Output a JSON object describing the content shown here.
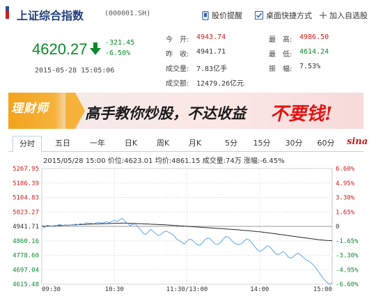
{
  "header": {
    "title": "上证综合指数",
    "code": "(000001.SH)",
    "links": [
      {
        "label": "股价提醒",
        "icon": "phone-icon"
      },
      {
        "label": "桌面快捷方式",
        "icon": "checkbox-icon"
      },
      {
        "label": "加入自选股",
        "icon": "plus-icon"
      }
    ]
  },
  "quote": {
    "price": "4620.27",
    "change": "-321.45",
    "change_pct": "-6.50%",
    "time": "2015-05-28 15:05:06",
    "stats": [
      {
        "label": "今　开:",
        "value": "4943.74",
        "tone": "red"
      },
      {
        "label": "昨　收:",
        "value": "4941.71",
        "tone": "dark"
      },
      {
        "label": "成交量:",
        "value": "7.83亿手",
        "tone": "dark"
      },
      {
        "label": "成交额:",
        "value": "12479.26亿元",
        "tone": "dark"
      },
      {
        "label": "最　高:",
        "value": "4986.50",
        "tone": "red"
      },
      {
        "label": "最　低:",
        "value": "4614.24",
        "tone": "green"
      },
      {
        "label": "振　幅:",
        "value": "7.53%",
        "tone": "dark"
      }
    ]
  },
  "banner": {
    "logo": "理财师",
    "slogan": "高手教你炒股，不达收益",
    "cta": "不要钱!"
  },
  "tabs": [
    "分时",
    "五日",
    "一年",
    "日K",
    "周K",
    "月K",
    "5分",
    "15分",
    "30分",
    "60分"
  ],
  "active_tab": 0,
  "sina_logo": "sina",
  "info_line": "2015/05/28 15:00 价位:4623.01 均价:4861.15 成交量:74万 涨幅:-6.45%",
  "colors": {
    "up": "#d21a1a",
    "down": "#0a8a2a",
    "price_line": "#5aa6e8",
    "avg_line": "#222222",
    "accent": "#1f3f7a"
  },
  "chart_data": {
    "type": "line",
    "y_left_ticks": [
      "5267.95",
      "5186.39",
      "5104.83",
      "5023.27",
      "4941.71",
      "4860.16",
      "4778.60",
      "4697.04",
      "4615.48"
    ],
    "y_right_ticks": [
      "6.60%",
      "4.95%",
      "3.30%",
      "1.65%",
      "0",
      "-1.65%",
      "-3.30%",
      "-4.95%",
      "-6.60%"
    ],
    "x_ticks": [
      "09:30",
      "10:30",
      "11:30/13:00",
      "14:00",
      "15:00"
    ],
    "ylim": [
      4615.48,
      5267.95
    ],
    "series": [
      {
        "values": [
          4943.7,
          4934,
          4948,
          4945,
          4944,
          4940,
          4948,
          4952,
          4947,
          4950,
          4946,
          4949,
          4948,
          4955,
          4951,
          4957,
          4953,
          4962,
          4958,
          4960,
          4956,
          4962,
          4965,
          4960,
          4963,
          4968,
          4962,
          4970,
          4975,
          4968,
          4978,
          4986.5,
          4973,
          4960,
          4946,
          4952,
          4956,
          4940,
          4925,
          4905,
          4895,
          4910,
          4925,
          4912,
          4900,
          4890,
          4896,
          4910,
          4915,
          4908,
          4900,
          4890,
          4870,
          4862,
          4852,
          4842,
          4858,
          4870,
          4865,
          4850,
          4838,
          4835,
          4850,
          4868,
          4875,
          4870,
          4855,
          4842,
          4840,
          4852,
          4870,
          4884,
          4880,
          4866,
          4850,
          4842,
          4838,
          4845,
          4858,
          4870,
          4865,
          4850,
          4830,
          4812,
          4800,
          4806,
          4820,
          4832,
          4826,
          4808,
          4790,
          4782,
          4788,
          4800,
          4790,
          4770,
          4762,
          4770,
          4784,
          4790,
          4778,
          4765,
          4752,
          4745,
          4735,
          4720,
          4700,
          4680,
          4660,
          4640,
          4625,
          4614.2,
          4623.0
        ]
      },
      {
        "values": [
          4943.7,
          4942,
          4943,
          4944,
          4944,
          4945,
          4946,
          4946,
          4947,
          4948,
          4948,
          4949,
          4950,
          4950,
          4951,
          4952,
          4952,
          4953,
          4954,
          4954,
          4955,
          4955,
          4956,
          4956,
          4957,
          4957,
          4958,
          4958,
          4959,
          4959,
          4959,
          4960,
          4960,
          4959,
          4959,
          4958,
          4958,
          4957,
          4957,
          4956,
          4955,
          4955,
          4954,
          4953,
          4953,
          4952,
          4951,
          4951,
          4950,
          4949,
          4948,
          4947,
          4946,
          4945,
          4944,
          4943,
          4942,
          4941,
          4940,
          4939,
          4938,
          4937,
          4936,
          4935,
          4934,
          4933,
          4932,
          4931,
          4930,
          4929,
          4928,
          4927,
          4926,
          4925,
          4924,
          4923,
          4922,
          4920,
          4919,
          4918,
          4917,
          4915,
          4914,
          4912,
          4911,
          4909,
          4907,
          4906,
          4904,
          4902,
          4900,
          4898,
          4896,
          4894,
          4892,
          4890,
          4888,
          4886,
          4884,
          4882,
          4880,
          4878,
          4876,
          4874,
          4872,
          4870,
          4868,
          4866,
          4865,
          4863,
          4862,
          4861.5,
          4861.2
        ]
      }
    ]
  }
}
